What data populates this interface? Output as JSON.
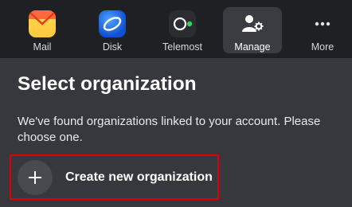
{
  "topbar": {
    "apps": [
      {
        "label": "Mail",
        "icon": "mail-icon",
        "active": false
      },
      {
        "label": "Disk",
        "icon": "disk-icon",
        "active": false
      },
      {
        "label": "Telemost",
        "icon": "telemost-icon",
        "active": false
      },
      {
        "label": "Manage",
        "icon": "manage-icon",
        "active": true
      },
      {
        "label": "More",
        "icon": "more-icon",
        "active": false
      }
    ]
  },
  "main": {
    "title": "Select organization",
    "description": "We've found organizations linked to your account. Please choose one.",
    "create_button": {
      "label": "Create new organization",
      "icon": "plus-icon"
    }
  },
  "colors": {
    "topbar_bg": "#1f2024",
    "page_bg": "#36383e",
    "highlight_border": "#e00000",
    "mail_yellow": "#ffcf3f",
    "disk_blue": "#1f6ee8",
    "telemost_green": "#2fd25a"
  }
}
